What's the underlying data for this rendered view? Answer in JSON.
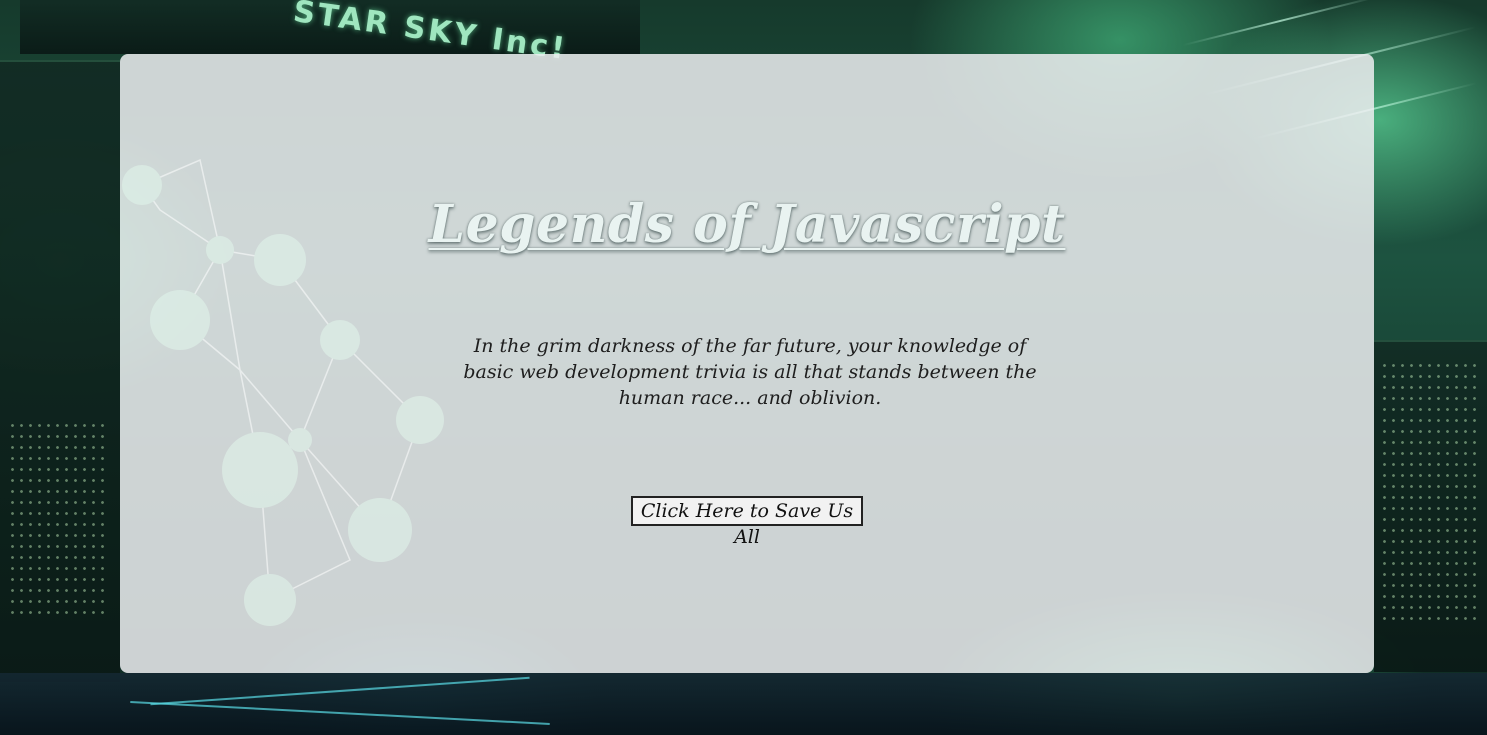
{
  "background": {
    "sign_text": "STAR SKY Inc!",
    "accent_color": "#3fd08a"
  },
  "main": {
    "title": "Legends of Javascript",
    "intro": "In the grim darkness of the far future, your knowledge of basic web development trivia is all that stands between the human race... and oblivion.",
    "start_button_label": "Click Here to Save Us All"
  }
}
